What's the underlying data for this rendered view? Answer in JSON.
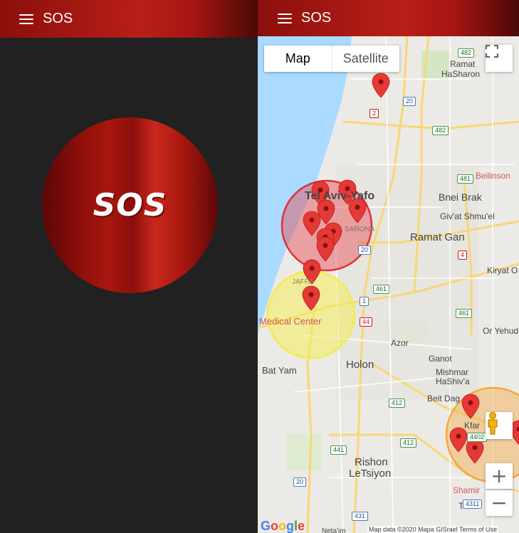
{
  "left_screen": {
    "app_title": "SOS",
    "sos_button_label": "SOS",
    "menu_icon": "menu-icon"
  },
  "right_screen": {
    "app_title": "SOS",
    "menu_icon": "menu-icon",
    "map": {
      "map_type_tabs": [
        {
          "label": "Map",
          "selected": true
        },
        {
          "label": "Satellite",
          "selected": false
        }
      ],
      "fullscreen_icon": "fullscreen-icon",
      "pegman_icon": "pegman-icon",
      "zoom_in": "+",
      "zoom_out": "−",
      "logo": "Google",
      "attribution": "Map data ©2020 Mapa GISrael   Terms of Use",
      "labels": {
        "ramat_hasharon_1": "Ramat",
        "ramat_hasharon_2": "HaSharon",
        "tel_aviv": "Tel Aviv-Yafo",
        "bnei_brak": "Bnei Brak",
        "beilinson": "Beilinson",
        "givat_shmuel": "Giv'at Shmu'el",
        "ramat_gan": "Ramat Gan",
        "kiryat_ono": "Kiryat O",
        "or_yehuda": "Or Yehud",
        "sarona": "SARONA",
        "jaffa": "JAFFA",
        "medical_center": "Medical Center",
        "azor": "Azor",
        "ganot": "Ganot",
        "mishmar_1": "Mishmar",
        "mishmar_2": "HaShiv'a",
        "bat_yam": "Bat Yam",
        "holon": "Holon",
        "beit_dagan": "Beit Dag",
        "kfar": "Kfar",
        "rishon_1": "Rishon",
        "rishon_2": "LeTsiyon",
        "shamir": "Shamir",
        "tsrifin": "Tsrifin",
        "netaim": "Neta'im"
      },
      "road_shields": [
        "482",
        "20",
        "2",
        "482",
        "481",
        "4",
        "20",
        "461",
        "1",
        "44",
        "461",
        "412",
        "4402",
        "441",
        "412",
        "20",
        "4311",
        "431"
      ],
      "colors": {
        "red_zone": "#e0303a",
        "yellow_zone": "#f2ec4a",
        "orange_zone": "#f2a93a",
        "marker": "#e53935",
        "water": "#aadaff"
      }
    }
  }
}
